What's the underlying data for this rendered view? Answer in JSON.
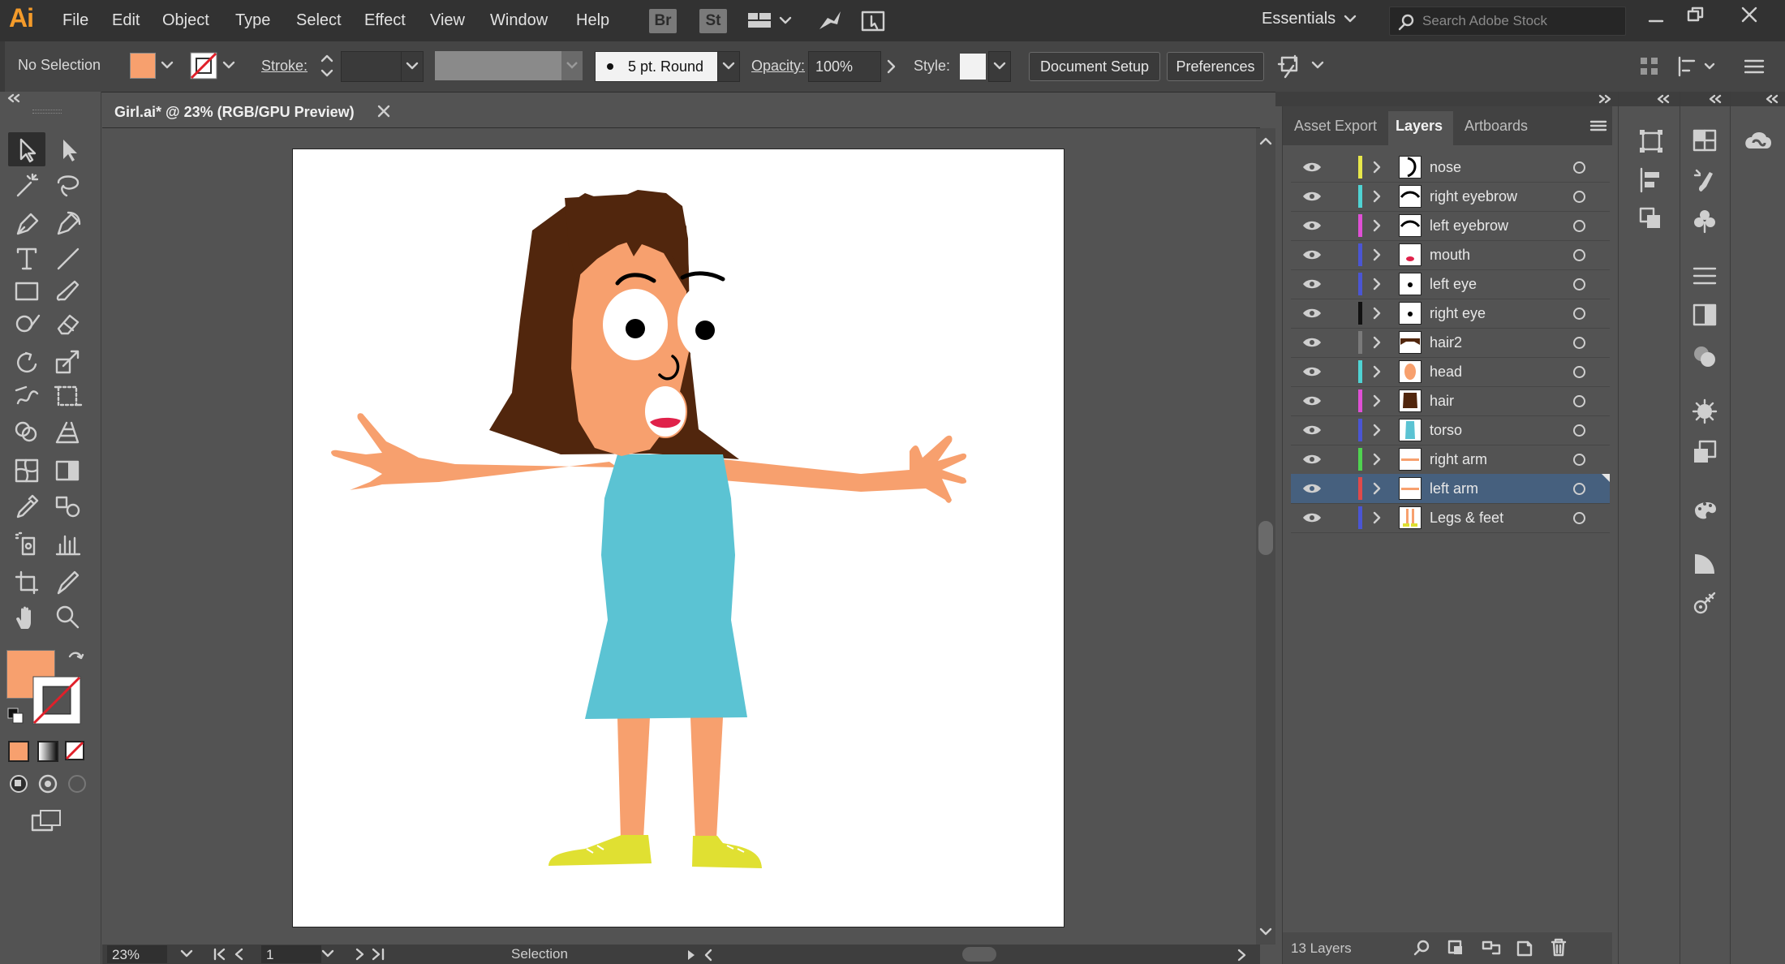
{
  "app": {
    "logo": "Ai",
    "workspace": "Essentials",
    "search_placeholder": "Search Adobe Stock"
  },
  "menu": [
    "File",
    "Edit",
    "Object",
    "Type",
    "Select",
    "Effect",
    "View",
    "Window",
    "Help"
  ],
  "bridge_badges": [
    "Br",
    "St"
  ],
  "control": {
    "selection": "No Selection",
    "stroke_label": "Stroke:",
    "brush": "5 pt. Round",
    "opacity_label": "Opacity:",
    "opacity_value": "100%",
    "style_label": "Style:",
    "document_setup": "Document Setup",
    "preferences": "Preferences",
    "fill_color": "#F7A06E"
  },
  "document": {
    "tab_title": "Girl.ai* @ 23% (RGB/GPU Preview)"
  },
  "status": {
    "zoom": "23%",
    "artboard": "1",
    "tool": "Selection"
  },
  "panel": {
    "tabs": [
      "Asset Export",
      "Layers",
      "Artboards"
    ],
    "active_tab": "Layers",
    "layer_count": "13 Layers",
    "layers": [
      {
        "name": "nose",
        "color": "#e8e84a"
      },
      {
        "name": "right eyebrow",
        "color": "#4fd3d3"
      },
      {
        "name": "left eyebrow",
        "color": "#e04fd6"
      },
      {
        "name": "mouth",
        "color": "#4a55d4"
      },
      {
        "name": "left eye",
        "color": "#4a55d4"
      },
      {
        "name": "right eye",
        "color": "#111111"
      },
      {
        "name": "hair2",
        "color": "#7a7a7a"
      },
      {
        "name": "head",
        "color": "#4fd3d3"
      },
      {
        "name": "hair",
        "color": "#e04fd6"
      },
      {
        "name": "torso",
        "color": "#4a55d4"
      },
      {
        "name": "right arm",
        "color": "#4fd34f"
      },
      {
        "name": "left arm",
        "color": "#e04a4a"
      },
      {
        "name": "Legs & feet",
        "color": "#4a55d4"
      }
    ],
    "selected_layer": "left arm"
  },
  "colors": {
    "skin": "#F7A06E",
    "hair": "#51260D",
    "dress": "#5BC3D3",
    "shoes": "#E0E032",
    "mouth": "#E0214A"
  }
}
